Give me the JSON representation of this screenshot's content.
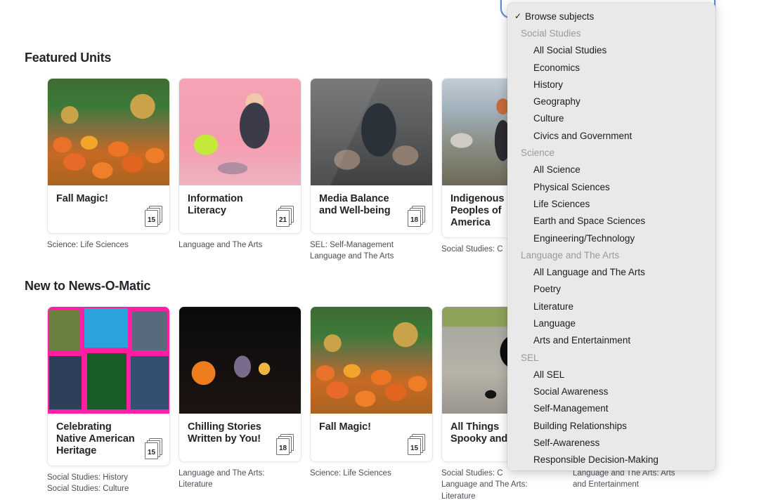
{
  "sections": [
    {
      "id": "featured",
      "heading": "Featured Units",
      "cards": [
        {
          "title": "Fall Magic!",
          "count": "15",
          "subject": "Science: Life Sciences",
          "art": "ph-pumpkin"
        },
        {
          "title": "Information Literacy",
          "count": "21",
          "subject": "Language and The Arts",
          "art": "ph-pink"
        },
        {
          "title": "Media Balance and Well-being",
          "count": "18",
          "subject": "SEL: Self-Management\nLanguage and The Arts",
          "art": "ph-phone"
        },
        {
          "title": "Indigenous Peoples of America",
          "count": "",
          "subject": "Social Studies: C",
          "art": "ph-cliff"
        },
        {
          "title": "",
          "count": "",
          "subject": "",
          "art": "ph-frame"
        }
      ]
    },
    {
      "id": "new",
      "heading": "New to News-O-Matic",
      "cards": [
        {
          "title": "Celebrating Native American Heritage",
          "count": "15",
          "subject": "Social Studies: History\nSocial Studies: Culture",
          "art": "ph-collage"
        },
        {
          "title": "Chilling Stories Written by You!",
          "count": "18",
          "subject": "Language and The Arts:\nLiterature",
          "art": "ph-spooky"
        },
        {
          "title": "Fall Magic!",
          "count": "15",
          "subject": "Science: Life Sciences",
          "art": "ph-pumpkin"
        },
        {
          "title": "All Things Spooky and",
          "count": "",
          "subject": "Social Studies: C\nLanguage and The Arts:\nLiterature",
          "art": "ph-cat"
        },
        {
          "title": "",
          "count": "",
          "subject": "Language and The Arts: Arts\nand Entertainment",
          "art": "ph-arts"
        }
      ]
    }
  ],
  "dropdown": {
    "selected_label": "Browse subjects",
    "checkmark": "✓",
    "items": [
      {
        "label": "Browse subjects",
        "type": "selected"
      },
      {
        "label": "Social Studies",
        "type": "group"
      },
      {
        "label": "All Social Studies",
        "type": "child"
      },
      {
        "label": "Economics",
        "type": "child"
      },
      {
        "label": "History",
        "type": "child"
      },
      {
        "label": "Geography",
        "type": "child"
      },
      {
        "label": "Culture",
        "type": "child"
      },
      {
        "label": "Civics and Government",
        "type": "child"
      },
      {
        "label": "Science",
        "type": "group"
      },
      {
        "label": "All Science",
        "type": "child"
      },
      {
        "label": "Physical Sciences",
        "type": "child"
      },
      {
        "label": "Life Sciences",
        "type": "child"
      },
      {
        "label": "Earth and Space Sciences",
        "type": "child"
      },
      {
        "label": "Engineering/Technology",
        "type": "child"
      },
      {
        "label": "Language and The Arts",
        "type": "group"
      },
      {
        "label": "All Language and The Arts",
        "type": "child"
      },
      {
        "label": "Poetry",
        "type": "child"
      },
      {
        "label": "Literature",
        "type": "child"
      },
      {
        "label": "Language",
        "type": "child"
      },
      {
        "label": "Arts and Entertainment",
        "type": "child"
      },
      {
        "label": "SEL",
        "type": "group"
      },
      {
        "label": "All SEL",
        "type": "child"
      },
      {
        "label": "Social Awareness",
        "type": "child"
      },
      {
        "label": "Self-Management",
        "type": "child"
      },
      {
        "label": "Building Relationships",
        "type": "child"
      },
      {
        "label": "Self-Awareness",
        "type": "child"
      },
      {
        "label": "Responsible Decision-Making",
        "type": "child"
      }
    ]
  },
  "colors": {
    "accent_focus": "#5b8dd9",
    "heading": "#22262a",
    "subject_text": "#4a4f57",
    "dropdown_bg": "#e9e9e9",
    "dropdown_group": "#9a9a9e"
  }
}
